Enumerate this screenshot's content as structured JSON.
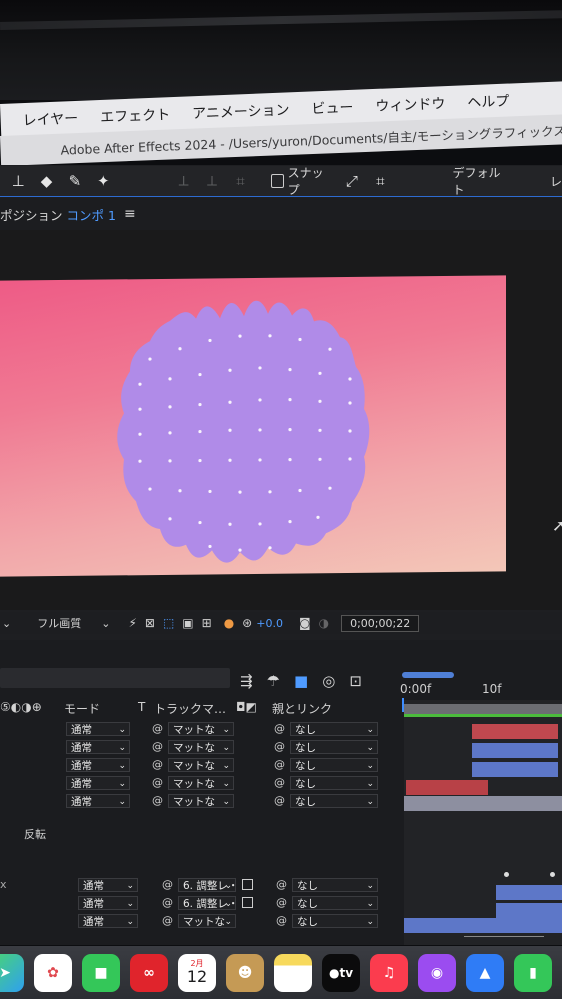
{
  "menu": [
    "レイヤー",
    "エフェクト",
    "アニメーション",
    "ビュー",
    "ウィンドウ",
    "ヘルプ"
  ],
  "window_title": "Adobe After Effects 2024 - /Users/yuron/Documents/自主/モーショングラフィックス_AM",
  "toolbar": {
    "snap_label": "スナップ",
    "workspace": "デフォルト",
    "workspace_next": "レ"
  },
  "panel": {
    "name": "ポジション",
    "comp": "コンポ 1",
    "menu_icon": "hamburger-icon"
  },
  "viewer_controls": {
    "quality": "フル画質",
    "exposure": "+0.0",
    "timecode": "0;00;00;22"
  },
  "timeline": {
    "ruler": [
      "0:00f",
      "10f"
    ],
    "columns": {
      "mode": "モード",
      "t": "T",
      "track_matte": "トラックマ…",
      "parent": "親とリンク"
    },
    "invert_label": "反転",
    "rows": [
      {
        "mode": "通常",
        "matte": "マットな",
        "parent": "なし"
      },
      {
        "mode": "通常",
        "matte": "マットな",
        "parent": "なし"
      },
      {
        "mode": "通常",
        "matte": "マットな",
        "parent": "なし"
      },
      {
        "mode": "通常",
        "matte": "マットな",
        "parent": "なし"
      },
      {
        "mode": "通常",
        "matte": "マットな",
        "parent": "なし"
      }
    ],
    "rows2": [
      {
        "mode": "通常",
        "matte": "6. 調整レ・",
        "parent": "なし"
      },
      {
        "mode": "通常",
        "matte": "6. 調整レ・",
        "parent": "なし"
      },
      {
        "mode": "通常",
        "matte": "マットな",
        "parent": "なし"
      }
    ]
  },
  "dock": {
    "calendar_month": "2月",
    "calendar_day": "12",
    "tv_label": "tv"
  },
  "colors": {
    "accent": "#2d6bd1",
    "bar_red": "#c0484f",
    "bar_blue": "#5d77c8",
    "blob": "#b08be8",
    "bg_pink": "#ee5b86",
    "bg_peach": "#f3c7b8"
  }
}
